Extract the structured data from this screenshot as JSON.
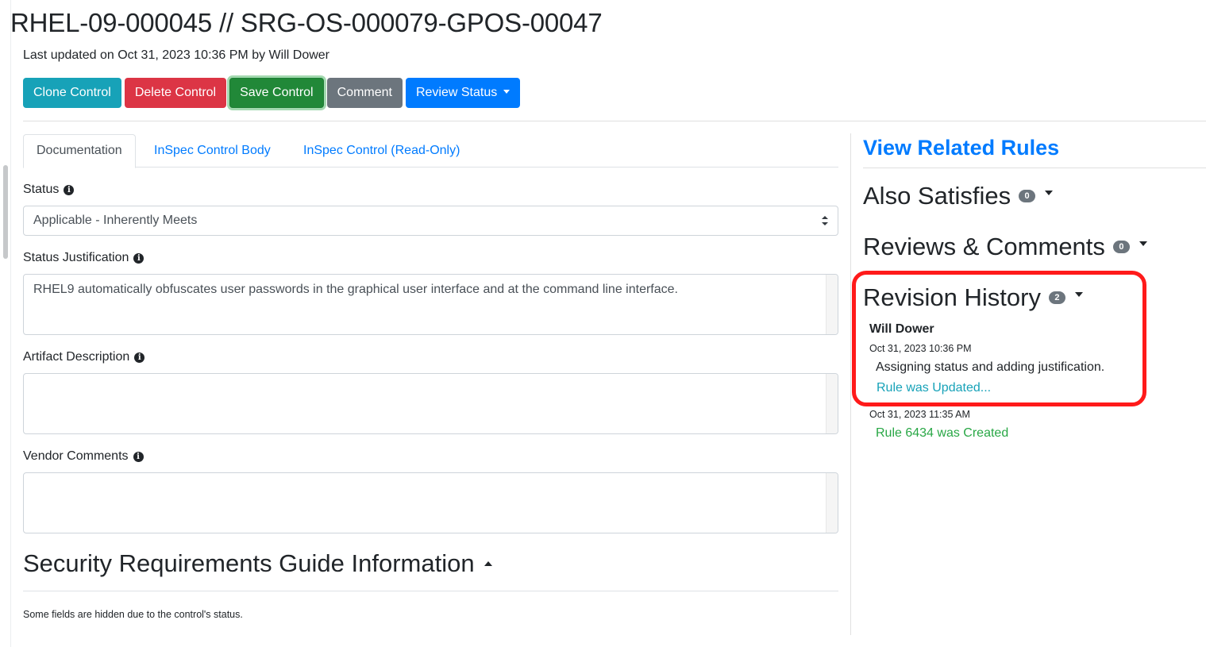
{
  "page": {
    "title": "RHEL-09-000045 // SRG-OS-000079-GPOS-00047",
    "last_updated": "Last updated on Oct 31, 2023 10:36 PM by Will Dower"
  },
  "toolbar": {
    "clone_label": "Clone Control",
    "delete_label": "Delete Control",
    "save_label": "Save Control",
    "comment_label": "Comment",
    "review_status_label": "Review Status"
  },
  "tabs": [
    {
      "label": "Documentation",
      "active": true
    },
    {
      "label": "InSpec Control Body",
      "active": false
    },
    {
      "label": "InSpec Control (Read-Only)",
      "active": false
    }
  ],
  "form": {
    "status_label": "Status",
    "status_value": "Applicable - Inherently Meets",
    "justification_label": "Status Justification",
    "justification_value": "RHEL9 automatically obfuscates user passwords in the graphical user interface and at the command line interface.",
    "artifact_label": "Artifact Description",
    "artifact_value": "",
    "vendor_comments_label": "Vendor Comments",
    "vendor_comments_value": ""
  },
  "srg_section": {
    "heading": "Security Requirements Guide Information",
    "note": "Some fields are hidden due to the control's status."
  },
  "sidebar": {
    "related_rules_link": "View Related Rules",
    "also_satisfies": {
      "title": "Also Satisfies",
      "count": "0"
    },
    "reviews_comments": {
      "title": "Reviews & Comments",
      "count": "0"
    },
    "revision_history": {
      "title": "Revision History",
      "count": "2",
      "entries": [
        {
          "author": "Will Dower",
          "timestamp": "Oct 31, 2023 10:36 PM",
          "comment": "Assigning status and adding justification.",
          "link": "Rule was Updated..."
        },
        {
          "timestamp": "Oct 31, 2023 11:35 AM",
          "message": "Rule 6434 was Created"
        }
      ]
    }
  },
  "colors": {
    "accent_link": "#007bff",
    "info": "#17a2b8",
    "danger": "#dc3545",
    "success": "#218838",
    "secondary": "#6c757d",
    "highlight": "#ff1a1a"
  }
}
